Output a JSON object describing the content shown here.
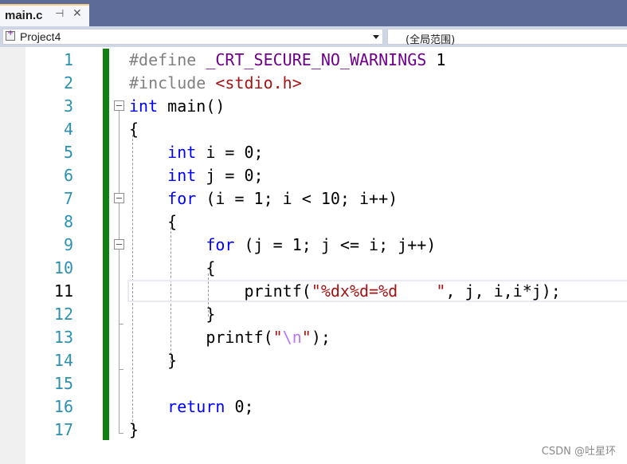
{
  "tab": {
    "title": "main.c",
    "pin_icon": "pin-icon",
    "pin_glyph": "⊣",
    "close_icon": "close-icon",
    "close_glyph": "✕",
    "active_accent": "#f5cc84"
  },
  "navbar": {
    "project": "Project4",
    "scope": "(全局范围)"
  },
  "editor": {
    "current_line": 11,
    "colors": {
      "line_number": "#2b91af",
      "keyword": "#0000ff",
      "preprocessor": "#808080",
      "macro": "#6f008a",
      "string": "#a31515",
      "escape": "#b776fb",
      "change_bar": "#108010"
    },
    "line_numbers": [
      "1",
      "2",
      "3",
      "4",
      "5",
      "6",
      "7",
      "8",
      "9",
      "10",
      "11",
      "12",
      "13",
      "14",
      "15",
      "16",
      "17"
    ],
    "lines": [
      {
        "tokens": [
          {
            "t": "pp",
            "v": "#define "
          },
          {
            "t": "macro",
            "v": "_CRT_SECURE_NO_WARNINGS"
          },
          {
            "t": "plain",
            "v": " 1"
          }
        ]
      },
      {
        "tokens": [
          {
            "t": "pp",
            "v": "#include "
          },
          {
            "t": "str",
            "v": "<stdio.h>"
          }
        ]
      },
      {
        "tokens": [
          {
            "t": "kw",
            "v": "int"
          },
          {
            "t": "plain",
            "v": " main()"
          }
        ]
      },
      {
        "tokens": [
          {
            "t": "plain",
            "v": "{"
          }
        ]
      },
      {
        "tokens": [
          {
            "t": "plain",
            "v": "    "
          },
          {
            "t": "kw",
            "v": "int"
          },
          {
            "t": "plain",
            "v": " i = 0;"
          }
        ]
      },
      {
        "tokens": [
          {
            "t": "plain",
            "v": "    "
          },
          {
            "t": "kw",
            "v": "int"
          },
          {
            "t": "plain",
            "v": " j = 0;"
          }
        ]
      },
      {
        "tokens": [
          {
            "t": "plain",
            "v": "    "
          },
          {
            "t": "kw",
            "v": "for"
          },
          {
            "t": "plain",
            "v": " (i = 1; i < 10; i++)"
          }
        ]
      },
      {
        "tokens": [
          {
            "t": "plain",
            "v": "    {"
          }
        ]
      },
      {
        "tokens": [
          {
            "t": "plain",
            "v": "        "
          },
          {
            "t": "kw",
            "v": "for"
          },
          {
            "t": "plain",
            "v": " (j = 1; j <= i; j++)"
          }
        ]
      },
      {
        "tokens": [
          {
            "t": "plain",
            "v": "        {"
          }
        ]
      },
      {
        "tokens": [
          {
            "t": "plain",
            "v": "            printf("
          },
          {
            "t": "str",
            "v": "\"%dx%d=%d    \""
          },
          {
            "t": "plain",
            "v": ", j, i,i*j);"
          }
        ]
      },
      {
        "tokens": [
          {
            "t": "plain",
            "v": "        }"
          }
        ]
      },
      {
        "tokens": [
          {
            "t": "plain",
            "v": "        printf("
          },
          {
            "t": "str",
            "v": "\""
          },
          {
            "t": "esc",
            "v": "\\n"
          },
          {
            "t": "str",
            "v": "\""
          },
          {
            "t": "plain",
            "v": ");"
          }
        ]
      },
      {
        "tokens": [
          {
            "t": "plain",
            "v": "    }"
          }
        ]
      },
      {
        "tokens": []
      },
      {
        "tokens": [
          {
            "t": "plain",
            "v": "    "
          },
          {
            "t": "kw",
            "v": "return"
          },
          {
            "t": "plain",
            "v": " 0;"
          }
        ]
      },
      {
        "tokens": [
          {
            "t": "plain",
            "v": "}"
          }
        ]
      }
    ]
  },
  "watermark": "CSDN @吐星环"
}
